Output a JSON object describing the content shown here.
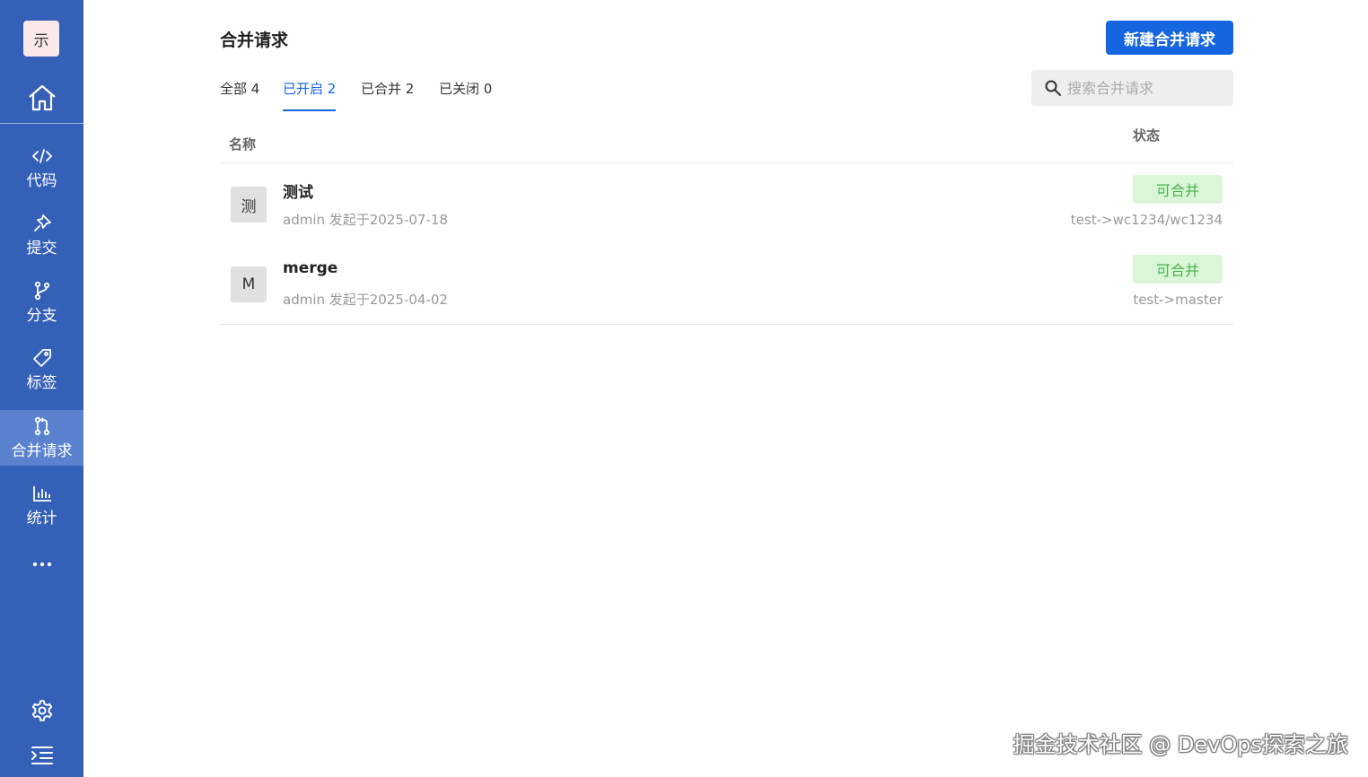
{
  "sidebar": {
    "logo_text": "示",
    "items": [
      {
        "label": "代码",
        "icon": "code-icon"
      },
      {
        "label": "提交",
        "icon": "pin-icon"
      },
      {
        "label": "分支",
        "icon": "branch-icon"
      },
      {
        "label": "标签",
        "icon": "tag-icon"
      },
      {
        "label": "合并请求",
        "icon": "merge-request-icon",
        "active": true
      },
      {
        "label": "统计",
        "icon": "bar-chart-icon"
      }
    ],
    "bg_color": "#3560b8",
    "active_color": "#5a82cf"
  },
  "header": {
    "title": "合并请求",
    "new_button": "新建合并请求"
  },
  "tabs": [
    {
      "label": "全部 4"
    },
    {
      "label": "已开启 2",
      "active": true
    },
    {
      "label": "已合并 2"
    },
    {
      "label": "已关闭 0"
    }
  ],
  "search": {
    "placeholder": "搜索合并请求"
  },
  "table": {
    "columns": {
      "name": "名称",
      "status": "状态"
    },
    "rows": [
      {
        "avatar": "测",
        "title": "测试",
        "meta": "admin 发起于2025-07-18",
        "badge": "可合并",
        "branch": "test->wc1234/wc1234"
      },
      {
        "avatar": "M",
        "title": "merge",
        "meta": "admin 发起于2025-04-02",
        "badge": "可合并",
        "branch": "test->master"
      }
    ]
  },
  "watermark": "掘金技术社区 @ DevOps探索之旅",
  "colors": {
    "accent": "#1565e0",
    "badge_bg": "#d9f7d6",
    "badge_text": "#4caf50"
  }
}
